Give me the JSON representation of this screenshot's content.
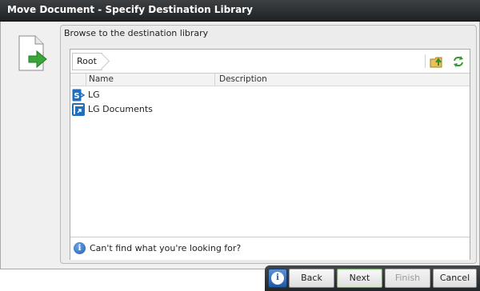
{
  "window": {
    "title": "Move Document - Specify Destination Library"
  },
  "panel": {
    "header": "Browse to the destination library"
  },
  "browser": {
    "breadcrumb": [
      "Root"
    ],
    "columns": {
      "name": "Name",
      "description": "Description"
    },
    "items": [
      {
        "name": "LG",
        "description": "",
        "icon": "sharepoint-site-icon"
      },
      {
        "name": "LG Documents",
        "description": "",
        "icon": "document-library-icon"
      }
    ],
    "footer_message": "Can't find what you're looking for?"
  },
  "buttons": {
    "help": "i",
    "back": "Back",
    "next": "Next",
    "finish": "Finish",
    "cancel": "Cancel"
  },
  "colors": {
    "titlebar": "#2b2e30",
    "accent_blue": "#1e5aa8",
    "arrow_green": "#3aa63a"
  }
}
